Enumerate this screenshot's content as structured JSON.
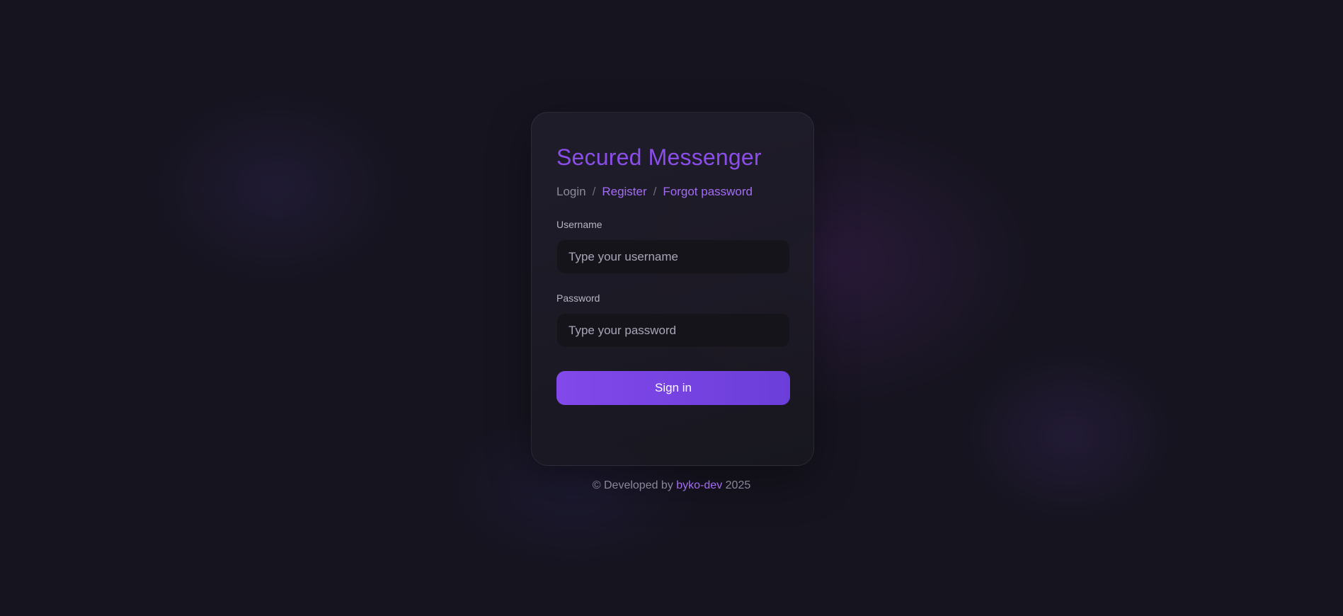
{
  "app": {
    "title": "Secured Messenger"
  },
  "nav": {
    "login": "Login",
    "separator": "/",
    "register": "Register",
    "forgot_password": "Forgot password"
  },
  "form": {
    "username": {
      "label": "Username",
      "placeholder": "Type your username",
      "value": ""
    },
    "password": {
      "label": "Password",
      "placeholder": "Type your password",
      "value": ""
    },
    "submit_label": "Sign in"
  },
  "footer": {
    "prefix": "© Developed by",
    "author": "byko-dev",
    "year": "2025"
  },
  "colors": {
    "accent": "#8b4ee8",
    "link": "#a46cf5",
    "background": "#16141f",
    "button_start": "#8248ea",
    "button_end": "#6b3ed9"
  }
}
